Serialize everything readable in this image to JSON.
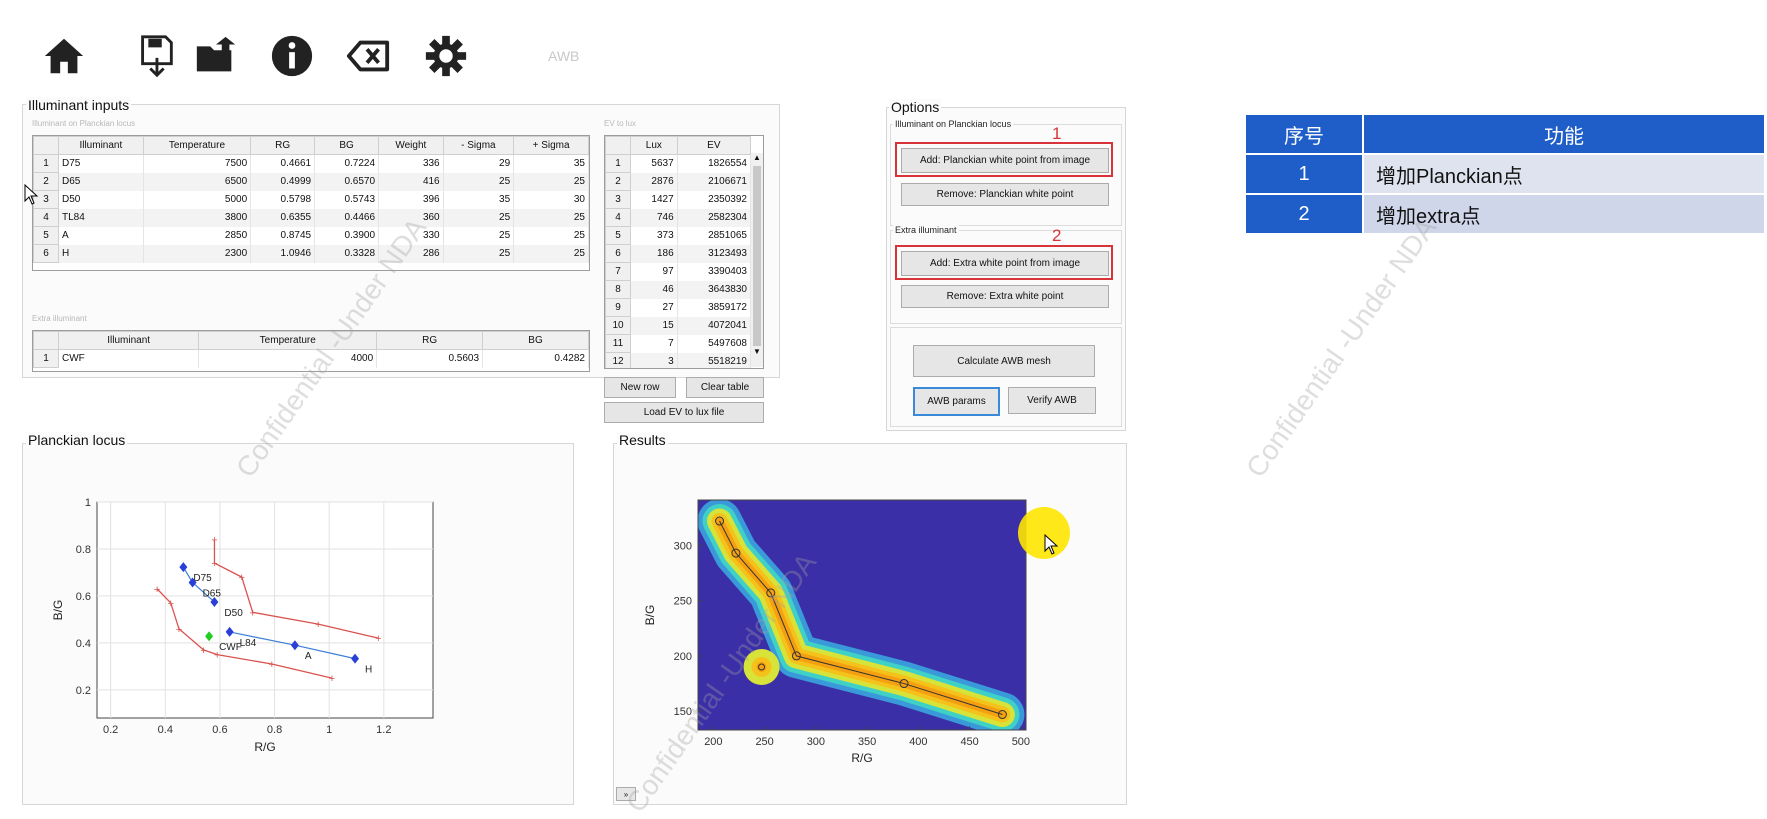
{
  "toolbar": {
    "buttons": [
      {
        "name": "home-icon"
      },
      {
        "name": "save-icon"
      },
      {
        "name": "open-folder-icon"
      },
      {
        "name": "info-icon"
      },
      {
        "name": "clear-icon"
      },
      {
        "name": "gear-icon"
      }
    ],
    "awb_label": "AWB"
  },
  "illuminant_inputs": {
    "title": "Illuminant inputs",
    "planckian_subtitle": "Illuminant on Planckian locus",
    "columns": [
      "Illuminant",
      "Temperature",
      "RG",
      "BG",
      "Weight",
      "- Sigma",
      "+ Sigma"
    ],
    "rows": [
      {
        "n": "1",
        "ill": "D75",
        "temp": "7500",
        "rg": "0.4661",
        "bg": "0.7224",
        "w": "336",
        "ms": "29",
        "ps": "35"
      },
      {
        "n": "2",
        "ill": "D65",
        "temp": "6500",
        "rg": "0.4999",
        "bg": "0.6570",
        "w": "416",
        "ms": "25",
        "ps": "25"
      },
      {
        "n": "3",
        "ill": "D50",
        "temp": "5000",
        "rg": "0.5798",
        "bg": "0.5743",
        "w": "396",
        "ms": "35",
        "ps": "30"
      },
      {
        "n": "4",
        "ill": "TL84",
        "temp": "3800",
        "rg": "0.6355",
        "bg": "0.4466",
        "w": "360",
        "ms": "25",
        "ps": "25"
      },
      {
        "n": "5",
        "ill": "A",
        "temp": "2850",
        "rg": "0.8745",
        "bg": "0.3900",
        "w": "330",
        "ms": "25",
        "ps": "25"
      },
      {
        "n": "6",
        "ill": "H",
        "temp": "2300",
        "rg": "1.0946",
        "bg": "0.3328",
        "w": "286",
        "ms": "25",
        "ps": "25"
      }
    ],
    "extra_subtitle": "Extra illuminant",
    "extra_columns": [
      "Illuminant",
      "Temperature",
      "RG",
      "BG"
    ],
    "extra_rows": [
      {
        "n": "1",
        "ill": "CWF",
        "temp": "4000",
        "rg": "0.5603",
        "bg": "0.4282"
      }
    ]
  },
  "ev_to_lux": {
    "subtitle": "EV to lux",
    "columns": [
      "Lux",
      "EV"
    ],
    "rows": [
      {
        "n": "1",
        "lux": "5637",
        "ev": "1826554"
      },
      {
        "n": "2",
        "lux": "2876",
        "ev": "2106671"
      },
      {
        "n": "3",
        "lux": "1427",
        "ev": "2350392"
      },
      {
        "n": "4",
        "lux": "746",
        "ev": "2582304"
      },
      {
        "n": "5",
        "lux": "373",
        "ev": "2851065"
      },
      {
        "n": "6",
        "lux": "186",
        "ev": "3123493"
      },
      {
        "n": "7",
        "lux": "97",
        "ev": "3390403"
      },
      {
        "n": "8",
        "lux": "46",
        "ev": "3643830"
      },
      {
        "n": "9",
        "lux": "27",
        "ev": "3859172"
      },
      {
        "n": "10",
        "lux": "15",
        "ev": "4072041"
      },
      {
        "n": "11",
        "lux": "7",
        "ev": "5497608"
      },
      {
        "n": "12",
        "lux": "3",
        "ev": "5518219"
      }
    ],
    "new_row": "New row",
    "clear_table": "Clear table",
    "load_file": "Load EV to lux file"
  },
  "options": {
    "title": "Options",
    "planckian_group": "Illuminant on Planckian locus",
    "add_planckian": "Add: Planckian white point from image",
    "remove_planckian": "Remove: Planckian white point",
    "extra_group": "Extra illuminant",
    "add_extra": "Add: Extra white point from image",
    "remove_extra": "Remove: Extra white point",
    "calc_mesh": "Calculate AWB mesh",
    "awb_params": "AWB params",
    "verify_awb": "Verify AWB",
    "marker_1": "1",
    "marker_2": "2"
  },
  "feature_table": {
    "headers": [
      "序号",
      "功能"
    ],
    "rows": [
      {
        "no": "1",
        "fn": "增加Planckian点"
      },
      {
        "no": "2",
        "fn": "增加extra点"
      }
    ]
  },
  "watermark": "Confidential -Under NDA",
  "colors": {
    "accent": "#1f5ec8",
    "highlight": "#d9333a",
    "heat_bg": "#3b2fa8"
  },
  "chart_data": [
    {
      "type": "scatter",
      "title": "Planckian locus",
      "xlabel": "R/G",
      "ylabel": "B/G",
      "xlim": [
        0.15,
        1.38
      ],
      "ylim": [
        0.08,
        1.0
      ],
      "xticks": [
        "0.2",
        "0.4",
        "0.6",
        "0.8",
        "1",
        "1.2"
      ],
      "yticks": [
        "0.2",
        "0.4",
        "0.6",
        "0.8",
        "1"
      ],
      "grid": true,
      "points": [
        {
          "label": "D75",
          "x": 0.4661,
          "y": 0.7224
        },
        {
          "label": "D65",
          "x": 0.4999,
          "y": 0.657
        },
        {
          "label": "D50",
          "x": 0.5798,
          "y": 0.5743
        },
        {
          "label": "L84",
          "x": 0.6355,
          "y": 0.4466
        },
        {
          "label": "A",
          "x": 0.8745,
          "y": 0.39
        },
        {
          "label": "H",
          "x": 1.0946,
          "y": 0.3328
        }
      ],
      "extra_points": [
        {
          "label": "CWF",
          "x": 0.5603,
          "y": 0.4282
        }
      ],
      "upper_bound": [
        [
          0.58,
          0.84
        ],
        [
          0.58,
          0.74
        ],
        [
          0.68,
          0.68
        ],
        [
          0.72,
          0.53
        ],
        [
          0.96,
          0.48
        ],
        [
          1.18,
          0.42
        ]
      ],
      "lower_bound": [
        [
          0.37,
          0.63
        ],
        [
          0.42,
          0.57
        ],
        [
          0.45,
          0.46
        ],
        [
          0.54,
          0.37
        ],
        [
          0.59,
          0.35
        ],
        [
          0.79,
          0.31
        ],
        [
          1.01,
          0.25
        ]
      ],
      "series_colors": {
        "points": "#2a3fd6",
        "bound": "#d9534f",
        "connector": "#3b7fd6",
        "extra": "#22cc22"
      }
    },
    {
      "type": "heatmap",
      "title": "Results",
      "xlabel": "R/G",
      "ylabel": "B/G",
      "xlim": [
        185,
        505
      ],
      "ylim": [
        133,
        341
      ],
      "xticks": [
        "200",
        "250",
        "300",
        "350",
        "400",
        "450",
        "500"
      ],
      "yticks": [
        "150",
        "200",
        "250",
        "300"
      ],
      "path": [
        [
          206,
          322
        ],
        [
          222,
          293
        ],
        [
          256,
          257
        ],
        [
          281,
          200
        ],
        [
          386,
          175
        ],
        [
          482,
          147
        ]
      ],
      "extra_point": [
        247,
        190
      ]
    }
  ]
}
